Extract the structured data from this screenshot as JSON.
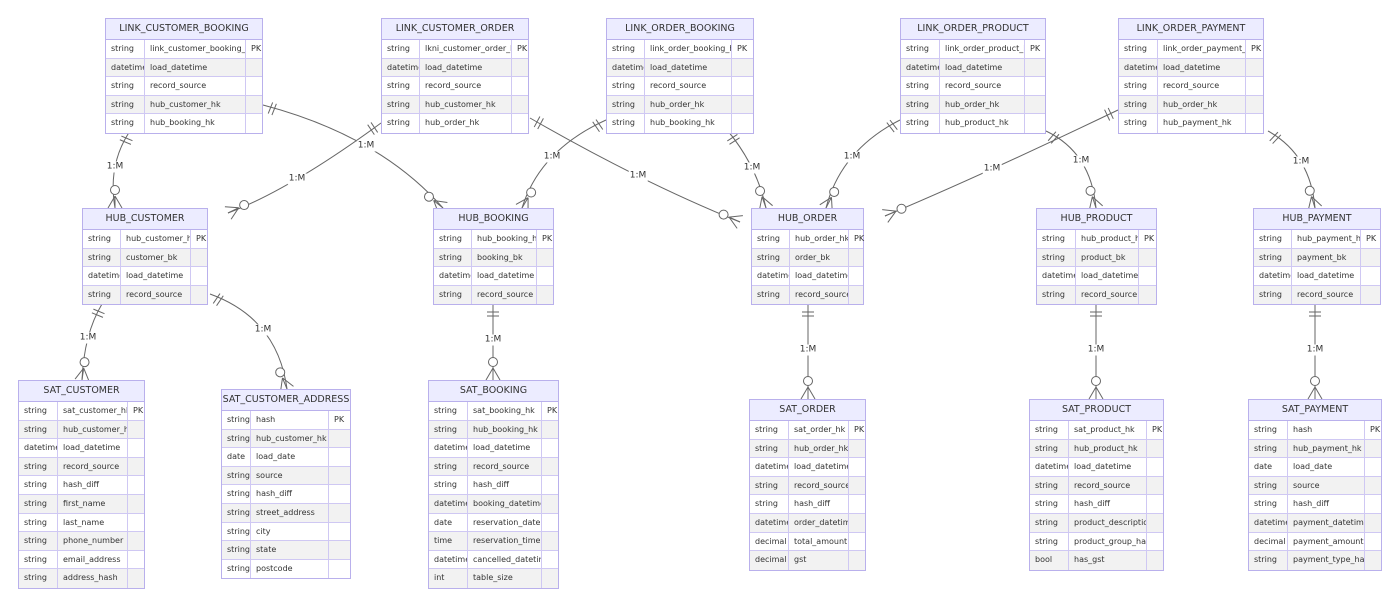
{
  "diagram": {
    "type": "entity-relationship",
    "colors": {
      "header_bg": "#ececff",
      "border": "#b9b0ec",
      "alt_row": "#f2f2f2",
      "line": "#666666"
    },
    "entities": [
      {
        "name": "LINK_CUSTOMER_BOOKING",
        "attributes": [
          [
            "string",
            "link_customer_booking_hk",
            "PK"
          ],
          [
            "datetime",
            "load_datetime",
            ""
          ],
          [
            "string",
            "record_source",
            ""
          ],
          [
            "string",
            "hub_customer_hk",
            ""
          ],
          [
            "string",
            "hub_booking_hk",
            ""
          ]
        ]
      },
      {
        "name": "LINK_CUSTOMER_ORDER",
        "attributes": [
          [
            "string",
            "lkni_customer_order_hk",
            "PK"
          ],
          [
            "datetime",
            "load_datetime",
            ""
          ],
          [
            "string",
            "record_source",
            ""
          ],
          [
            "string",
            "hub_customer_hk",
            ""
          ],
          [
            "string",
            "hub_order_hk",
            ""
          ]
        ]
      },
      {
        "name": "LINK_ORDER_BOOKING",
        "attributes": [
          [
            "string",
            "link_order_booking_hk",
            "PK"
          ],
          [
            "datetime",
            "load_datetime",
            ""
          ],
          [
            "string",
            "record_source",
            ""
          ],
          [
            "string",
            "hub_order_hk",
            ""
          ],
          [
            "string",
            "hub_booking_hk",
            ""
          ]
        ]
      },
      {
        "name": "LINK_ORDER_PRODUCT",
        "attributes": [
          [
            "string",
            "link_order_product_hk",
            "PK"
          ],
          [
            "datetime",
            "load_datetime",
            ""
          ],
          [
            "string",
            "record_source",
            ""
          ],
          [
            "string",
            "hub_order_hk",
            ""
          ],
          [
            "string",
            "hub_product_hk",
            ""
          ]
        ]
      },
      {
        "name": "LINK_ORDER_PAYMENT",
        "attributes": [
          [
            "string",
            "link_order_payment_hk",
            "PK"
          ],
          [
            "datetime",
            "load_datetime",
            ""
          ],
          [
            "string",
            "record_source",
            ""
          ],
          [
            "string",
            "hub_order_hk",
            ""
          ],
          [
            "string",
            "hub_payment_hk",
            ""
          ]
        ]
      },
      {
        "name": "HUB_CUSTOMER",
        "attributes": [
          [
            "string",
            "hub_customer_hk",
            "PK"
          ],
          [
            "string",
            "customer_bk",
            ""
          ],
          [
            "datetime",
            "load_datetime",
            ""
          ],
          [
            "string",
            "record_source",
            ""
          ]
        ]
      },
      {
        "name": "HUB_BOOKING",
        "attributes": [
          [
            "string",
            "hub_booking_hk",
            "PK"
          ],
          [
            "string",
            "booking_bk",
            ""
          ],
          [
            "datetime",
            "load_datetime",
            ""
          ],
          [
            "string",
            "record_source",
            ""
          ]
        ]
      },
      {
        "name": "HUB_ORDER",
        "attributes": [
          [
            "string",
            "hub_order_hk",
            "PK"
          ],
          [
            "string",
            "order_bk",
            ""
          ],
          [
            "datetime",
            "load_datetime",
            ""
          ],
          [
            "string",
            "record_source",
            ""
          ]
        ]
      },
      {
        "name": "HUB_PRODUCT",
        "attributes": [
          [
            "string",
            "hub_product_hk",
            "PK"
          ],
          [
            "string",
            "product_bk",
            ""
          ],
          [
            "datetime",
            "load_datetime",
            ""
          ],
          [
            "string",
            "record_source",
            ""
          ]
        ]
      },
      {
        "name": "HUB_PAYMENT",
        "attributes": [
          [
            "string",
            "hub_payment_hk",
            "PK"
          ],
          [
            "string",
            "payment_bk",
            ""
          ],
          [
            "datetime",
            "load_datetime",
            ""
          ],
          [
            "string",
            "record_source",
            ""
          ]
        ]
      },
      {
        "name": "SAT_CUSTOMER",
        "attributes": [
          [
            "string",
            "sat_customer_hk",
            "PK"
          ],
          [
            "string",
            "hub_customer_hk",
            ""
          ],
          [
            "datetime",
            "load_datetime",
            ""
          ],
          [
            "string",
            "record_source",
            ""
          ],
          [
            "string",
            "hash_diff",
            ""
          ],
          [
            "string",
            "first_name",
            ""
          ],
          [
            "string",
            "last_name",
            ""
          ],
          [
            "string",
            "phone_number",
            ""
          ],
          [
            "string",
            "email_address",
            ""
          ],
          [
            "string",
            "address_hash",
            ""
          ]
        ]
      },
      {
        "name": "SAT_CUSTOMER_ADDRESS",
        "attributes": [
          [
            "string",
            "hash",
            "PK"
          ],
          [
            "string",
            "hub_customer_hk",
            ""
          ],
          [
            "date",
            "load_date",
            ""
          ],
          [
            "string",
            "source",
            ""
          ],
          [
            "string",
            "hash_diff",
            ""
          ],
          [
            "string",
            "street_address",
            ""
          ],
          [
            "string",
            "city",
            ""
          ],
          [
            "string",
            "state",
            ""
          ],
          [
            "string",
            "postcode",
            ""
          ]
        ]
      },
      {
        "name": "SAT_BOOKING",
        "attributes": [
          [
            "string",
            "sat_booking_hk",
            "PK"
          ],
          [
            "string",
            "hub_booking_hk",
            ""
          ],
          [
            "datetime",
            "load_datetime",
            ""
          ],
          [
            "string",
            "record_source",
            ""
          ],
          [
            "string",
            "hash_diff",
            ""
          ],
          [
            "datetime",
            "booking_datetime",
            ""
          ],
          [
            "date",
            "reservation_date",
            ""
          ],
          [
            "time",
            "reservation_time",
            ""
          ],
          [
            "datetime",
            "cancelled_datetime",
            ""
          ],
          [
            "int",
            "table_size",
            ""
          ]
        ]
      },
      {
        "name": "SAT_ORDER",
        "attributes": [
          [
            "string",
            "sat_order_hk",
            "PK"
          ],
          [
            "string",
            "hub_order_hk",
            ""
          ],
          [
            "datetime",
            "load_datetime",
            ""
          ],
          [
            "string",
            "record_source",
            ""
          ],
          [
            "string",
            "hash_diff",
            ""
          ],
          [
            "datetime",
            "order_datetime",
            ""
          ],
          [
            "decimal",
            "total_amount",
            ""
          ],
          [
            "decimal",
            "gst",
            ""
          ]
        ]
      },
      {
        "name": "SAT_PRODUCT",
        "attributes": [
          [
            "string",
            "sat_product_hk",
            "PK"
          ],
          [
            "string",
            "hub_product_hk",
            ""
          ],
          [
            "datetime",
            "load_datetime",
            ""
          ],
          [
            "string",
            "record_source",
            ""
          ],
          [
            "string",
            "hash_diff",
            ""
          ],
          [
            "string",
            "product_description",
            ""
          ],
          [
            "string",
            "product_group_hash",
            ""
          ],
          [
            "bool",
            "has_gst",
            ""
          ]
        ]
      },
      {
        "name": "SAT_PAYMENT",
        "attributes": [
          [
            "string",
            "hash",
            "PK"
          ],
          [
            "string",
            "hub_payment_hk",
            ""
          ],
          [
            "date",
            "load_date",
            ""
          ],
          [
            "string",
            "source",
            ""
          ],
          [
            "string",
            "hash_diff",
            ""
          ],
          [
            "datetime",
            "payment_datetime",
            ""
          ],
          [
            "decimal",
            "payment_amount",
            ""
          ],
          [
            "string",
            "payment_type_hash",
            ""
          ]
        ]
      }
    ],
    "relationships": [
      {
        "from": "LINK_CUSTOMER_BOOKING",
        "to": "HUB_CUSTOMER",
        "label": "1:M"
      },
      {
        "from": "LINK_CUSTOMER_BOOKING",
        "to": "HUB_BOOKING",
        "label": "1:M"
      },
      {
        "from": "LINK_CUSTOMER_ORDER",
        "to": "HUB_CUSTOMER",
        "label": "1:M"
      },
      {
        "from": "LINK_CUSTOMER_ORDER",
        "to": "HUB_ORDER",
        "label": "1:M"
      },
      {
        "from": "LINK_ORDER_BOOKING",
        "to": "HUB_BOOKING",
        "label": "1:M"
      },
      {
        "from": "LINK_ORDER_BOOKING",
        "to": "HUB_ORDER",
        "label": "1:M"
      },
      {
        "from": "LINK_ORDER_PRODUCT",
        "to": "HUB_ORDER",
        "label": "1:M"
      },
      {
        "from": "LINK_ORDER_PRODUCT",
        "to": "HUB_PRODUCT",
        "label": "1:M"
      },
      {
        "from": "LINK_ORDER_PAYMENT",
        "to": "HUB_ORDER",
        "label": "1:M"
      },
      {
        "from": "LINK_ORDER_PAYMENT",
        "to": "HUB_PAYMENT",
        "label": "1:M"
      },
      {
        "from": "HUB_CUSTOMER",
        "to": "SAT_CUSTOMER",
        "label": "1:M"
      },
      {
        "from": "HUB_CUSTOMER",
        "to": "SAT_CUSTOMER_ADDRESS",
        "label": "1:M"
      },
      {
        "from": "HUB_BOOKING",
        "to": "SAT_BOOKING",
        "label": "1:M"
      },
      {
        "from": "HUB_ORDER",
        "to": "SAT_ORDER",
        "label": "1:M"
      },
      {
        "from": "HUB_PRODUCT",
        "to": "SAT_PRODUCT",
        "label": "1:M"
      },
      {
        "from": "HUB_PAYMENT",
        "to": "SAT_PAYMENT",
        "label": "1:M"
      }
    ]
  }
}
